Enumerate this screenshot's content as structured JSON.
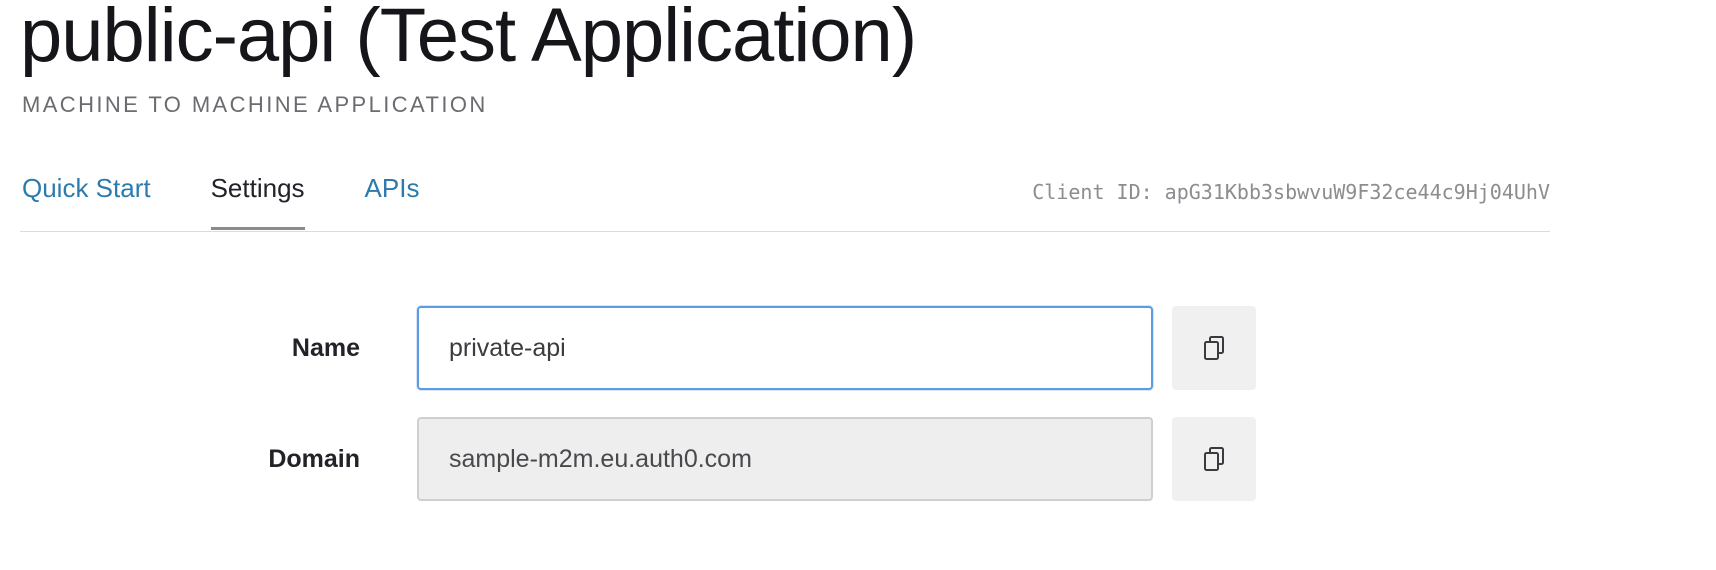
{
  "header": {
    "title": "public-api (Test Application)",
    "app_type": "MACHINE TO MACHINE APPLICATION"
  },
  "tabs": [
    {
      "label": "Quick Start",
      "active": false
    },
    {
      "label": "Settings",
      "active": true
    },
    {
      "label": "APIs",
      "active": false
    }
  ],
  "client_id": {
    "text": "Client ID: apG31Kbb3sbwvuW9F32ce44c9Hj04UhV"
  },
  "form": {
    "name": {
      "label": "Name",
      "value": "private-api"
    },
    "domain": {
      "label": "Domain",
      "value": "sample-m2m.eu.auth0.com"
    }
  },
  "icons": {
    "copy": "copy-icon"
  },
  "colors": {
    "link": "#2d7bae",
    "focus_border": "#5b9de0",
    "readonly_bg": "#eeeeee"
  }
}
